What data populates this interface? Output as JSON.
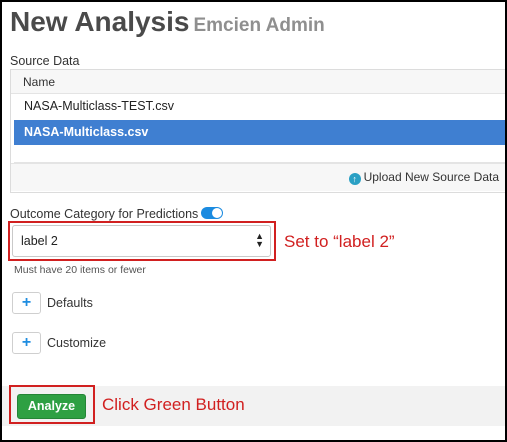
{
  "page": {
    "title": "New Analysis",
    "subtitle": "Emcien Admin"
  },
  "source_data": {
    "label": "Source Data",
    "column_header": "Name",
    "files": [
      {
        "name": "NASA-Multiclass-TEST.csv",
        "selected": false
      },
      {
        "name": "NASA-Multiclass.csv",
        "selected": true
      }
    ],
    "upload_label": "Upload New Source Data",
    "upload_icon": "upload-circle-icon"
  },
  "outcome": {
    "label": "Outcome Category for Predictions",
    "toggle_on": true,
    "selected_value": "label 2",
    "helper_text": "Must have 20 items or fewer"
  },
  "sections": {
    "defaults_label": "Defaults",
    "customize_label": "Customize",
    "plus_symbol": "+"
  },
  "actions": {
    "analyze_label": "Analyze"
  },
  "annotations": {
    "select_note": "Set to “label 2”",
    "button_note": "Click Green Button",
    "color": "#d12020"
  },
  "colors": {
    "selected_row": "#3f7fd1",
    "analyze_button": "#2ea043",
    "toggle": "#1b8be0"
  }
}
